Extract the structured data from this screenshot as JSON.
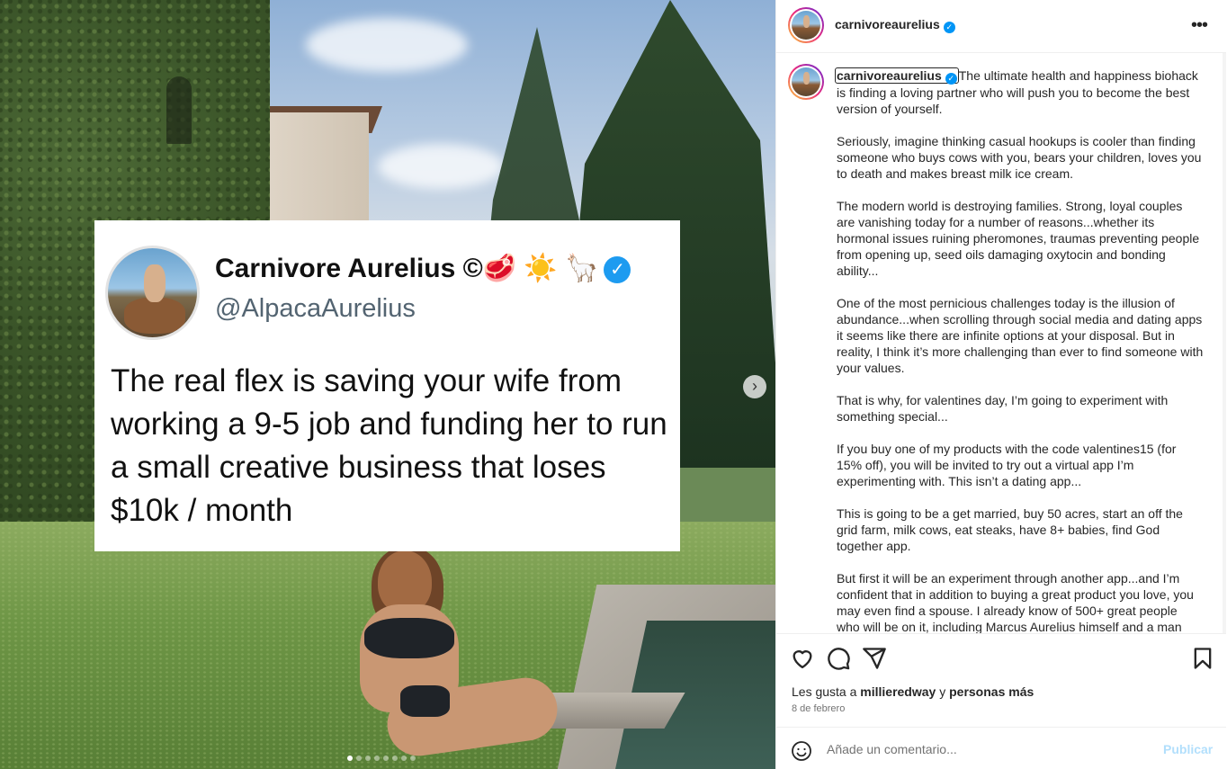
{
  "post": {
    "username": "carnivoreaurelius",
    "verified": true,
    "more_icon": "more-horizontal-icon"
  },
  "tweet": {
    "name": "Carnivore Aurelius ©🥩 ☀️ 🦙",
    "handle": "@AlpacaAurelius",
    "text": "The real flex is saving your wife from working a 9-5 job and funding her to run a small creative business that loses $10k / month"
  },
  "caption": {
    "username": "carnivoreaurelius",
    "paragraphs": [
      "The ultimate health and happiness biohack is finding a loving partner who will push you to become the best version of yourself.",
      "Seriously, imagine thinking casual hookups is cooler than finding someone who buys cows with you, bears your children, loves you to death and makes breast milk ice cream.",
      "The modern world is destroying families. Strong, loyal couples are vanishing today for a number of reasons...whether its hormonal issues ruining pheromones, traumas preventing people from opening up, seed oils damaging oxytocin and bonding ability...",
      "One of the most pernicious challenges today is the illusion of abundance...when scrolling through social media and dating apps it seems like there are infinite options at your disposal. But in reality, I think it’s more challenging than ever to find someone with your values.",
      "That is why, for valentines day, I’m going to experiment with something special...",
      "If you buy one of my products with the code valentines15 (for 15% off), you will be invited to try out a virtual app I’m experimenting with. This isn’t a dating app...",
      "This is going to be a get married, buy 50 acres, start an off the grid farm, milk cows, eat steaks, have 8+ babies, find God together app.",
      "But first it will be an experiment through another app...and I’m confident that in addition to buying a great product you love, you may even find a spouse. I already know of 500+ great people who will be on it, including Marcus Aurelius himself and a man who’s known to be able to speak to scottish cows."
    ]
  },
  "actions": {
    "like_icon": "heart-icon",
    "comment_icon": "comment-icon",
    "share_icon": "send-icon",
    "save_icon": "bookmark-icon"
  },
  "likes": {
    "prefix": "Les gusta a",
    "user": "millieredway",
    "conjunction": "y",
    "others": "personas más"
  },
  "date": "8 de febrero",
  "comment": {
    "placeholder": "Añade un comentario...",
    "publish_label": "Publicar",
    "emoji_icon": "emoji-icon"
  },
  "carousel": {
    "total_slides": 8,
    "active_index": 0,
    "next_icon": "chevron-right-icon"
  }
}
